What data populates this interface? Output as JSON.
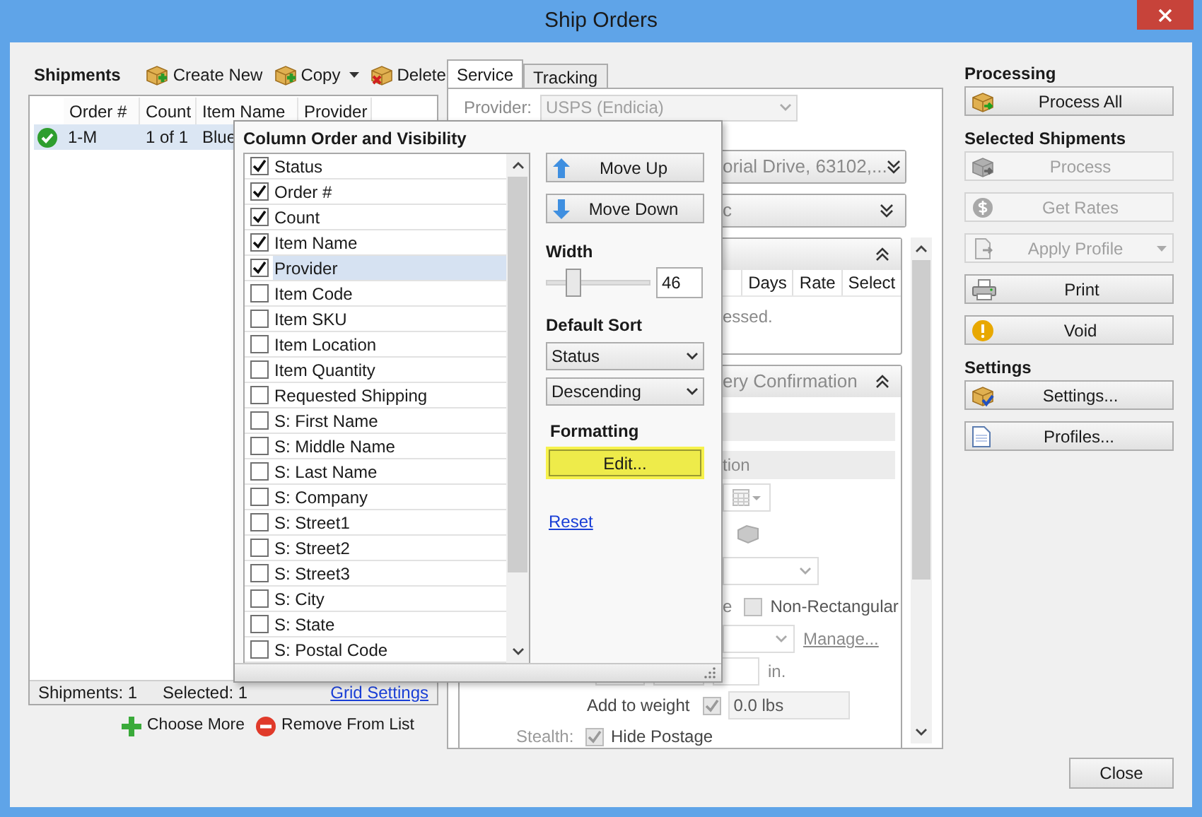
{
  "window": {
    "title": "Ship Orders"
  },
  "shipments": {
    "title": "Shipments",
    "toolbar": [
      {
        "label": "Create New",
        "kind": "create",
        "dropdown": false
      },
      {
        "label": "Copy",
        "kind": "copy",
        "dropdown": true
      },
      {
        "label": "Delete",
        "kind": "delete",
        "dropdown": false
      }
    ],
    "columns": [
      "Order #",
      "Count",
      "Item Name",
      "Provider"
    ],
    "rows": [
      {
        "selected": true,
        "order": "1-M",
        "count": "1 of 1",
        "item": "Blue"
      }
    ],
    "footer": {
      "shipments": "Shipments: 1",
      "selected": "Selected: 1",
      "link": "Grid Settings"
    },
    "actions": [
      {
        "label": "Choose More",
        "kind": "add"
      },
      {
        "label": "Remove From List",
        "kind": "remove"
      }
    ]
  },
  "tabs": [
    {
      "label": "Service",
      "selected": true
    },
    {
      "label": "Tracking",
      "selected": false
    }
  ],
  "service": {
    "provider_label": "Provider:",
    "provider_value": "USPS (Endicia)",
    "sections": [
      {
        "text": "orial Drive, 63102,...",
        "expanded": false
      },
      {
        "text": "c",
        "expanded": false
      }
    ],
    "rates": {
      "expanded": true,
      "columns": [
        "Days",
        "Rate",
        "Select"
      ],
      "message": "essed."
    },
    "confirmation": {
      "text": "ery Confirmation",
      "expanded": true,
      "subheader": "tion",
      "prefix": "e",
      "non_rectangular": {
        "label": "Non-Rectangular",
        "checked": false
      },
      "manage_link": "Manage...",
      "unit": "in.",
      "add_to_weight": {
        "label": "Add to weight",
        "checked": true,
        "value": "0.0 lbs"
      },
      "stealth": {
        "label": "Stealth:",
        "option": "Hide Postage",
        "checked": true
      }
    }
  },
  "column_popup": {
    "title": "Column Order and Visibility",
    "columns": [
      {
        "label": "Status",
        "checked": true,
        "selected": false
      },
      {
        "label": "Order #",
        "checked": true,
        "selected": false
      },
      {
        "label": "Count",
        "checked": true,
        "selected": false
      },
      {
        "label": "Item Name",
        "checked": true,
        "selected": false
      },
      {
        "label": "Provider",
        "checked": true,
        "selected": true
      },
      {
        "label": "Item Code",
        "checked": false,
        "selected": false
      },
      {
        "label": "Item SKU",
        "checked": false,
        "selected": false
      },
      {
        "label": "Item Location",
        "checked": false,
        "selected": false
      },
      {
        "label": "Item Quantity",
        "checked": false,
        "selected": false
      },
      {
        "label": "Requested Shipping",
        "checked": false,
        "selected": false
      },
      {
        "label": "S: First Name",
        "checked": false,
        "selected": false
      },
      {
        "label": "S: Middle Name",
        "checked": false,
        "selected": false
      },
      {
        "label": "S: Last Name",
        "checked": false,
        "selected": false
      },
      {
        "label": "S: Company",
        "checked": false,
        "selected": false
      },
      {
        "label": "S: Street1",
        "checked": false,
        "selected": false
      },
      {
        "label": "S: Street2",
        "checked": false,
        "selected": false
      },
      {
        "label": "S: Street3",
        "checked": false,
        "selected": false
      },
      {
        "label": "S: City",
        "checked": false,
        "selected": false
      },
      {
        "label": "S: State",
        "checked": false,
        "selected": false
      },
      {
        "label": "S: Postal Code",
        "checked": false,
        "selected": false
      }
    ],
    "move_up": "Move Up",
    "move_down": "Move Down",
    "width_label": "Width",
    "width": {
      "level": 0.25,
      "value": "46"
    },
    "sort_label": "Default Sort",
    "sort_column": "Status",
    "sort_direction": "Descending",
    "formatting_label": "Formatting",
    "edit": "Edit...",
    "reset": "Reset"
  },
  "sidebar": [
    {
      "title": "Processing",
      "buttons": [
        {
          "label": "Process All",
          "kind": "process",
          "disabled": false,
          "dropdown": false
        }
      ]
    },
    {
      "title": "Selected Shipments",
      "buttons": [
        {
          "label": "Process",
          "kind": "process",
          "disabled": true,
          "dropdown": false
        },
        {
          "label": "Get Rates",
          "kind": "rates",
          "disabled": true,
          "dropdown": false
        },
        {
          "label": "Apply Profile",
          "kind": "profile",
          "disabled": true,
          "dropdown": true
        },
        {
          "label": "Print",
          "kind": "print",
          "disabled": false,
          "dropdown": false
        },
        {
          "label": "Void",
          "kind": "void",
          "disabled": false,
          "dropdown": false
        }
      ]
    },
    {
      "title": "Settings",
      "buttons": [
        {
          "label": "Settings...",
          "kind": "settings",
          "disabled": false,
          "dropdown": false
        },
        {
          "label": "Profiles...",
          "kind": "document",
          "disabled": false,
          "dropdown": false
        }
      ]
    }
  ],
  "close": "Close"
}
